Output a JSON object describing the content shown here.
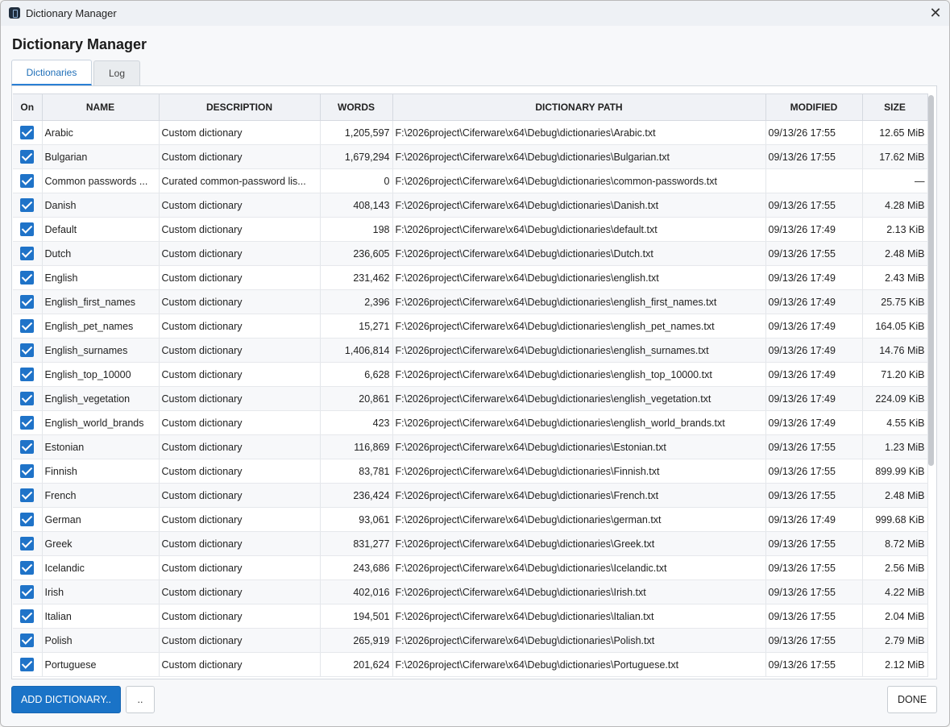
{
  "window": {
    "title": "Dictionary Manager",
    "close_glyph": "✕"
  },
  "heading": "Dictionary Manager",
  "tabs": [
    {
      "label": "Dictionaries",
      "active": true
    },
    {
      "label": "Log",
      "active": false
    }
  ],
  "table": {
    "headers": [
      "On",
      "NAME",
      "DESCRIPTION",
      "WORDS",
      "DICTIONARY PATH",
      "MODIFIED",
      "SIZE"
    ],
    "rows": [
      {
        "on": true,
        "name": "Arabic",
        "description": "Custom dictionary",
        "words": "1,205,597",
        "path": "F:\\2026project\\Ciferware\\x64\\Debug\\dictionaries\\Arabic.txt",
        "modified": "09/13/26 17:55",
        "size": "12.65 MiB"
      },
      {
        "on": true,
        "name": "Bulgarian",
        "description": "Custom dictionary",
        "words": "1,679,294",
        "path": "F:\\2026project\\Ciferware\\x64\\Debug\\dictionaries\\Bulgarian.txt",
        "modified": "09/13/26 17:55",
        "size": "17.62 MiB"
      },
      {
        "on": true,
        "name": "Common passwords ...",
        "description": "Curated common-password lis...",
        "words": "0",
        "path": "F:\\2026project\\Ciferware\\x64\\Debug\\dictionaries\\common-passwords.txt",
        "modified": "",
        "size": "—"
      },
      {
        "on": true,
        "name": "Danish",
        "description": "Custom dictionary",
        "words": "408,143",
        "path": "F:\\2026project\\Ciferware\\x64\\Debug\\dictionaries\\Danish.txt",
        "modified": "09/13/26 17:55",
        "size": "4.28 MiB"
      },
      {
        "on": true,
        "name": "Default",
        "description": "Custom dictionary",
        "words": "198",
        "path": "F:\\2026project\\Ciferware\\x64\\Debug\\dictionaries\\default.txt",
        "modified": "09/13/26 17:49",
        "size": "2.13 KiB"
      },
      {
        "on": true,
        "name": "Dutch",
        "description": "Custom dictionary",
        "words": "236,605",
        "path": "F:\\2026project\\Ciferware\\x64\\Debug\\dictionaries\\Dutch.txt",
        "modified": "09/13/26 17:55",
        "size": "2.48 MiB"
      },
      {
        "on": true,
        "name": "English",
        "description": "Custom dictionary",
        "words": "231,462",
        "path": "F:\\2026project\\Ciferware\\x64\\Debug\\dictionaries\\english.txt",
        "modified": "09/13/26 17:49",
        "size": "2.43 MiB"
      },
      {
        "on": true,
        "name": "English_first_names",
        "description": "Custom dictionary",
        "words": "2,396",
        "path": "F:\\2026project\\Ciferware\\x64\\Debug\\dictionaries\\english_first_names.txt",
        "modified": "09/13/26 17:49",
        "size": "25.75 KiB"
      },
      {
        "on": true,
        "name": "English_pet_names",
        "description": "Custom dictionary",
        "words": "15,271",
        "path": "F:\\2026project\\Ciferware\\x64\\Debug\\dictionaries\\english_pet_names.txt",
        "modified": "09/13/26 17:49",
        "size": "164.05 KiB"
      },
      {
        "on": true,
        "name": "English_surnames",
        "description": "Custom dictionary",
        "words": "1,406,814",
        "path": "F:\\2026project\\Ciferware\\x64\\Debug\\dictionaries\\english_surnames.txt",
        "modified": "09/13/26 17:49",
        "size": "14.76 MiB"
      },
      {
        "on": true,
        "name": "English_top_10000",
        "description": "Custom dictionary",
        "words": "6,628",
        "path": "F:\\2026project\\Ciferware\\x64\\Debug\\dictionaries\\english_top_10000.txt",
        "modified": "09/13/26 17:49",
        "size": "71.20 KiB"
      },
      {
        "on": true,
        "name": "English_vegetation",
        "description": "Custom dictionary",
        "words": "20,861",
        "path": "F:\\2026project\\Ciferware\\x64\\Debug\\dictionaries\\english_vegetation.txt",
        "modified": "09/13/26 17:49",
        "size": "224.09 KiB"
      },
      {
        "on": true,
        "name": "English_world_brands",
        "description": "Custom dictionary",
        "words": "423",
        "path": "F:\\2026project\\Ciferware\\x64\\Debug\\dictionaries\\english_world_brands.txt",
        "modified": "09/13/26 17:49",
        "size": "4.55 KiB"
      },
      {
        "on": true,
        "name": "Estonian",
        "description": "Custom dictionary",
        "words": "116,869",
        "path": "F:\\2026project\\Ciferware\\x64\\Debug\\dictionaries\\Estonian.txt",
        "modified": "09/13/26 17:55",
        "size": "1.23 MiB"
      },
      {
        "on": true,
        "name": "Finnish",
        "description": "Custom dictionary",
        "words": "83,781",
        "path": "F:\\2026project\\Ciferware\\x64\\Debug\\dictionaries\\Finnish.txt",
        "modified": "09/13/26 17:55",
        "size": "899.99 KiB"
      },
      {
        "on": true,
        "name": "French",
        "description": "Custom dictionary",
        "words": "236,424",
        "path": "F:\\2026project\\Ciferware\\x64\\Debug\\dictionaries\\French.txt",
        "modified": "09/13/26 17:55",
        "size": "2.48 MiB"
      },
      {
        "on": true,
        "name": "German",
        "description": "Custom dictionary",
        "words": "93,061",
        "path": "F:\\2026project\\Ciferware\\x64\\Debug\\dictionaries\\german.txt",
        "modified": "09/13/26 17:49",
        "size": "999.68 KiB"
      },
      {
        "on": true,
        "name": "Greek",
        "description": "Custom dictionary",
        "words": "831,277",
        "path": "F:\\2026project\\Ciferware\\x64\\Debug\\dictionaries\\Greek.txt",
        "modified": "09/13/26 17:55",
        "size": "8.72 MiB"
      },
      {
        "on": true,
        "name": "Icelandic",
        "description": "Custom dictionary",
        "words": "243,686",
        "path": "F:\\2026project\\Ciferware\\x64\\Debug\\dictionaries\\Icelandic.txt",
        "modified": "09/13/26 17:55",
        "size": "2.56 MiB"
      },
      {
        "on": true,
        "name": "Irish",
        "description": "Custom dictionary",
        "words": "402,016",
        "path": "F:\\2026project\\Ciferware\\x64\\Debug\\dictionaries\\Irish.txt",
        "modified": "09/13/26 17:55",
        "size": "4.22 MiB"
      },
      {
        "on": true,
        "name": "Italian",
        "description": "Custom dictionary",
        "words": "194,501",
        "path": "F:\\2026project\\Ciferware\\x64\\Debug\\dictionaries\\Italian.txt",
        "modified": "09/13/26 17:55",
        "size": "2.04 MiB"
      },
      {
        "on": true,
        "name": "Polish",
        "description": "Custom dictionary",
        "words": "265,919",
        "path": "F:\\2026project\\Ciferware\\x64\\Debug\\dictionaries\\Polish.txt",
        "modified": "09/13/26 17:55",
        "size": "2.79 MiB"
      },
      {
        "on": true,
        "name": "Portuguese",
        "description": "Custom dictionary",
        "words": "201,624",
        "path": "F:\\2026project\\Ciferware\\x64\\Debug\\dictionaries\\Portuguese.txt",
        "modified": "09/13/26 17:55",
        "size": "2.12 MiB"
      }
    ]
  },
  "footer": {
    "add_label": "ADD DICTIONARY..",
    "more_label": "..",
    "done_label": "DONE"
  },
  "colors": {
    "accent": "#1a73c7",
    "checkbox": "#1f73c8"
  }
}
